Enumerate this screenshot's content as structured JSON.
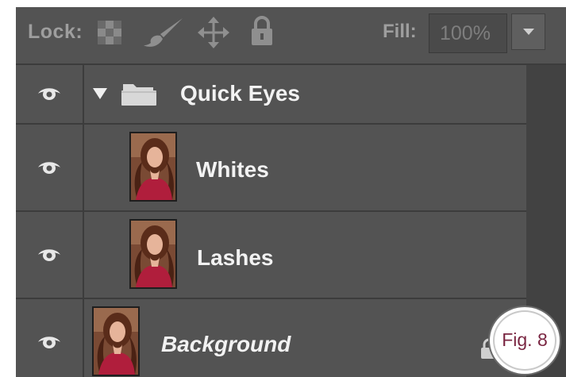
{
  "toolbar": {
    "lock_label": "Lock:",
    "lock_icons": [
      "lock-transparent-pixels-icon",
      "lock-image-pixels-icon",
      "lock-position-icon",
      "lock-all-icon"
    ],
    "fill_label": "Fill:",
    "fill_value": "100%"
  },
  "layers": [
    {
      "name": "Quick Eyes",
      "type": "group",
      "icon": "folder-icon",
      "visible": true,
      "expanded": true
    },
    {
      "name": "Whites",
      "type": "layer",
      "thumbnail": "portrait-thumbnail",
      "visible": true
    },
    {
      "name": "Lashes",
      "type": "layer",
      "thumbnail": "portrait-thumbnail",
      "visible": true
    },
    {
      "name": "Background",
      "type": "background",
      "thumbnail": "portrait-thumbnail",
      "visible": true,
      "italic": true
    }
  ],
  "badge": {
    "text": "Fig. 8"
  },
  "colors": {
    "panel_bg": "#535353",
    "divider": "#3c3c3c",
    "text": "#f2f2f2",
    "toolbar_text": "#9e9e9e",
    "badge_text": "#7a2642"
  }
}
